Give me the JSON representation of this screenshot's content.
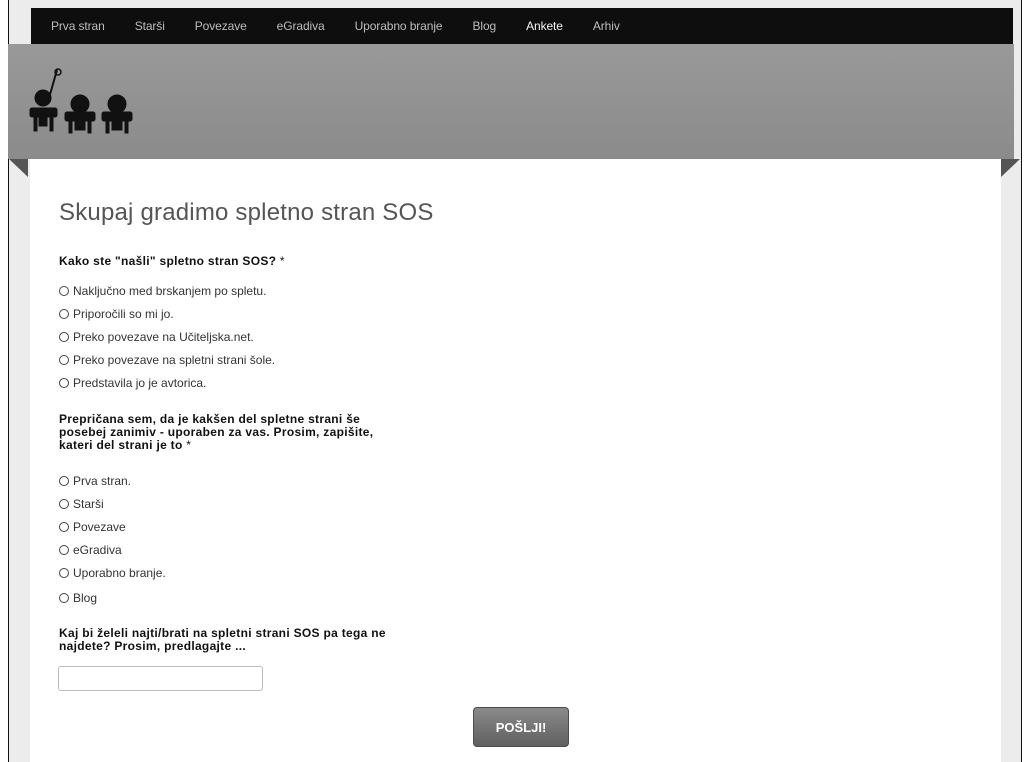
{
  "nav": {
    "items": [
      {
        "label": "Prva stran"
      },
      {
        "label": "Starši"
      },
      {
        "label": "Povezave"
      },
      {
        "label": "eGradiva"
      },
      {
        "label": "Uporabno branje"
      },
      {
        "label": "Blog"
      },
      {
        "label": "Ankete"
      },
      {
        "label": "Arhiv"
      }
    ],
    "active": "Ankete"
  },
  "page": {
    "title": "Skupaj gradimo spletno stran SOS"
  },
  "form": {
    "required_mark": "*",
    "q1": {
      "label": "Kako ste \"našli\" spletno stran SOS?",
      "options": [
        "Naključno med brskanjem po spletu.",
        "Priporočili so mi jo.",
        "Preko povezave na Učiteljska.net.",
        "Preko povezave na spletni strani šole.",
        "Predstavila jo je avtorica."
      ]
    },
    "q2": {
      "label_lines": [
        "Prepričana sem, da je kakšen del spletne strani še",
        "posebej zanimiv - uporaben za vas. Prosim, zapišite,",
        "kateri del strani je to"
      ],
      "options": [
        "Prva stran.",
        "Starši",
        "Povezave",
        "eGradiva",
        "Uporabno branje.",
        "Blog"
      ]
    },
    "q3": {
      "label_lines": [
        "Kaj bi želeli najti/brati na spletni strani SOS pa tega ne",
        "najdete? Prosim, predlagajte ..."
      ],
      "value": ""
    },
    "submit_label": "POŠLJI!"
  },
  "icons": {
    "logo": "three-cartoon-figures-logo"
  }
}
